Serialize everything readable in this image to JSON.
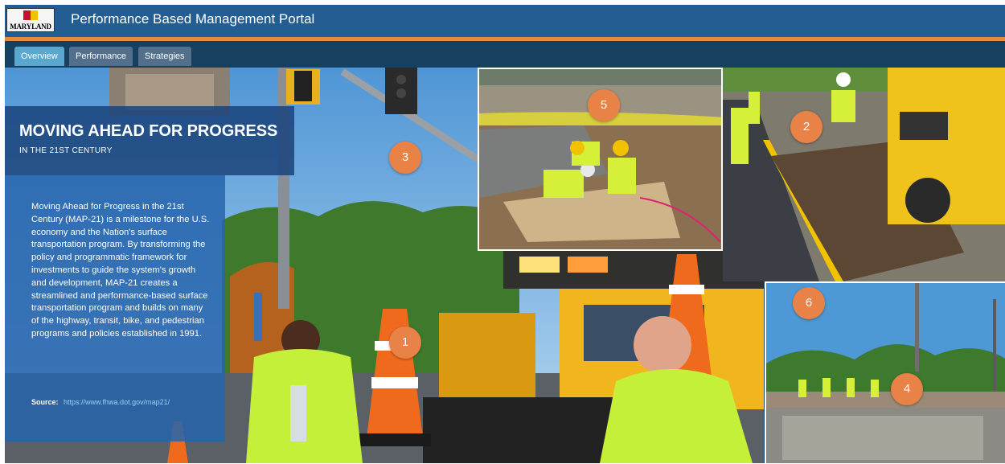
{
  "header": {
    "logo_text": "MARYLAND",
    "title": "Performance Based Management Portal"
  },
  "tabs": [
    {
      "label": "Overview",
      "active": true
    },
    {
      "label": "Performance",
      "active": false
    },
    {
      "label": "Strategies",
      "active": false
    }
  ],
  "hero": {
    "title": "MOVING AHEAD FOR PROGRESS",
    "subtitle": "IN THE 21ST CENTURY",
    "description": "Moving Ahead for Progress in the 21st Century (MAP-21) is a milestone for the U.S. economy and the Nation's surface transportation program. By transforming the policy and programmatic framework for investments to guide the system's growth and development, MAP-21 creates a streamlined and performance-based surface transportation program and builds on many of the highway, transit, bike, and pedestrian programs and policies established in 1991.",
    "source_label": "Source:",
    "source_url": "https://www.fhwa.dot.gov/map21/"
  },
  "markers": [
    {
      "label": "1"
    },
    {
      "label": "2"
    },
    {
      "label": "3"
    },
    {
      "label": "4"
    },
    {
      "label": "5"
    },
    {
      "label": "6"
    }
  ],
  "colors": {
    "header_blue": "#245d92",
    "accent_orange": "#e8893a",
    "active_tab": "#5aa8cf",
    "marker_orange": "#e98247"
  }
}
